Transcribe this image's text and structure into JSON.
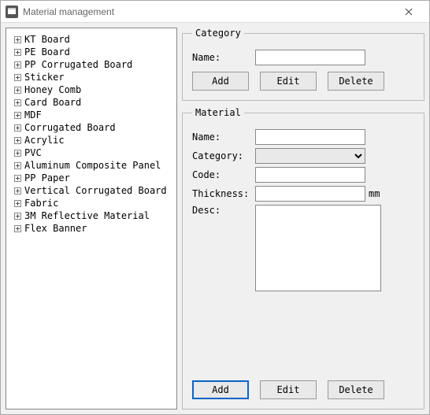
{
  "window": {
    "title": "Material management"
  },
  "tree": {
    "items": [
      "KT Board",
      "PE Board",
      "PP Corrugated Board",
      "Sticker",
      "Honey Comb",
      "Card Board",
      "MDF",
      "Corrugated Board",
      "Acrylic",
      "PVC",
      "Aluminum Composite Panel",
      "PP Paper",
      "Vertical Corrugated Board",
      "Fabric",
      "3M Reflective Material",
      "Flex Banner"
    ]
  },
  "category": {
    "legend": "Category",
    "name_label": "Name:",
    "name_value": "",
    "buttons": {
      "add": "Add",
      "edit": "Edit",
      "delete": "Delete"
    }
  },
  "material": {
    "legend": "Material",
    "name_label": "Name:",
    "name_value": "",
    "category_label": "Category:",
    "category_value": "",
    "code_label": "Code:",
    "code_value": "",
    "thickness_label": "Thickness:",
    "thickness_value": "",
    "thickness_unit": "mm",
    "desc_label": "Desc:",
    "desc_value": "",
    "buttons": {
      "add": "Add",
      "edit": "Edit",
      "delete": "Delete"
    }
  }
}
